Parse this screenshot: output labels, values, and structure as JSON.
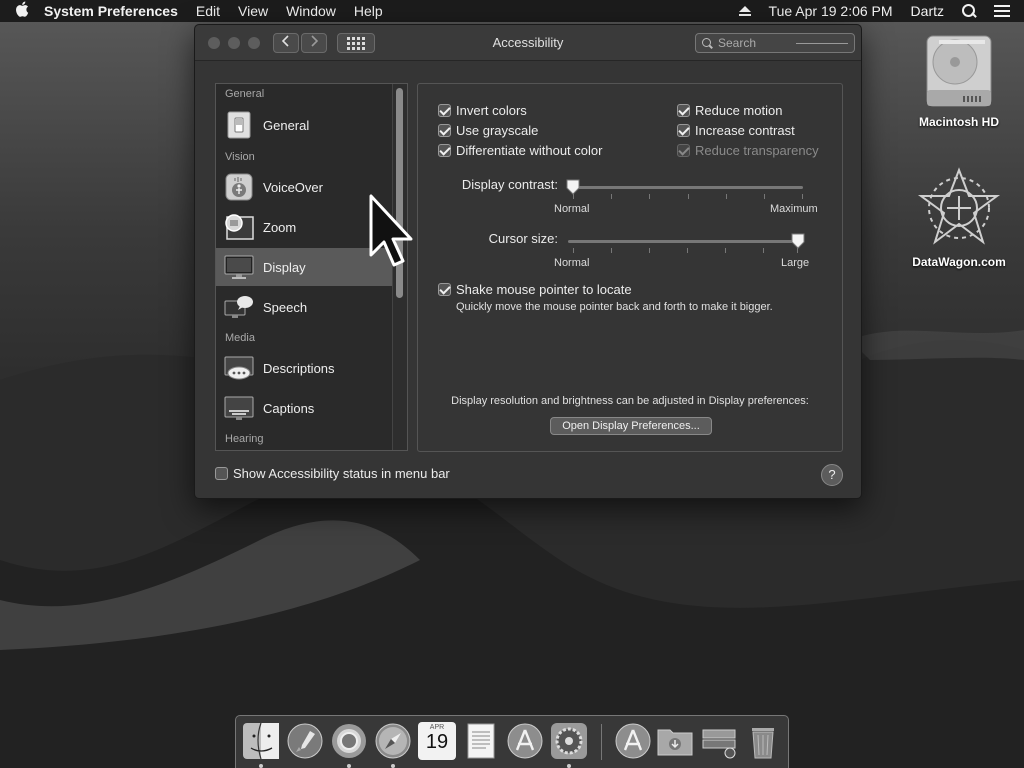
{
  "menubar": {
    "app_name": "System Preferences",
    "menus": [
      "Edit",
      "View",
      "Window",
      "Help"
    ],
    "clock": "Tue Apr 19  2:06 PM",
    "user": "Dartz"
  },
  "window": {
    "title": "Accessibility",
    "search_placeholder": "Search"
  },
  "sidebar": {
    "sections": [
      "General",
      "Vision",
      "Media",
      "Hearing"
    ],
    "items": [
      {
        "label": "General",
        "icon": "switch-icon"
      },
      {
        "label": "VoiceOver",
        "icon": "voiceover-icon"
      },
      {
        "label": "Zoom",
        "icon": "zoom-icon"
      },
      {
        "label": "Display",
        "icon": "display-icon",
        "selected": true
      },
      {
        "label": "Speech",
        "icon": "speech-icon"
      },
      {
        "label": "Descriptions",
        "icon": "descriptions-icon"
      },
      {
        "label": "Captions",
        "icon": "captions-icon"
      }
    ]
  },
  "display": {
    "options_left": [
      {
        "label": "Invert colors",
        "checked": true
      },
      {
        "label": "Use grayscale",
        "checked": true
      },
      {
        "label": "Differentiate without color",
        "checked": true
      }
    ],
    "options_right": [
      {
        "label": "Reduce motion",
        "checked": true
      },
      {
        "label": "Increase contrast",
        "checked": true
      },
      {
        "label": "Reduce transparency",
        "checked": true,
        "disabled": true
      }
    ],
    "contrast": {
      "label": "Display contrast:",
      "min_label": "Normal",
      "max_label": "Maximum",
      "value": 0.0
    },
    "cursor_size": {
      "label": "Cursor size:",
      "min_label": "Normal",
      "max_label": "Large",
      "value": 1.0
    },
    "shake": {
      "label": "Shake mouse pointer to locate",
      "checked": true,
      "help": "Quickly move the mouse pointer back and forth to make it bigger."
    },
    "resolution_note": "Display resolution and brightness can be adjusted in Display preferences:",
    "open_button": "Open Display Preferences..."
  },
  "footer": {
    "status_checkbox": "Show Accessibility status in menu bar",
    "status_checked": false,
    "help": "?"
  },
  "desktop": {
    "icons": [
      {
        "label": "Macintosh HD",
        "icon": "hard-drive-icon"
      },
      {
        "label": "DataWagon.com",
        "icon": "mandala-icon"
      }
    ]
  },
  "dock": {
    "items": [
      "finder-icon",
      "launchpad-icon",
      "chrome-icon",
      "safari-icon",
      "calendar-icon",
      "textedit-icon",
      "app-store-icon",
      "system-preferences-icon",
      "app-store-download-icon",
      "downloads-folder-icon",
      "stack-icon",
      "trash-icon"
    ],
    "calendar": {
      "month": "APR",
      "day": "19"
    }
  }
}
